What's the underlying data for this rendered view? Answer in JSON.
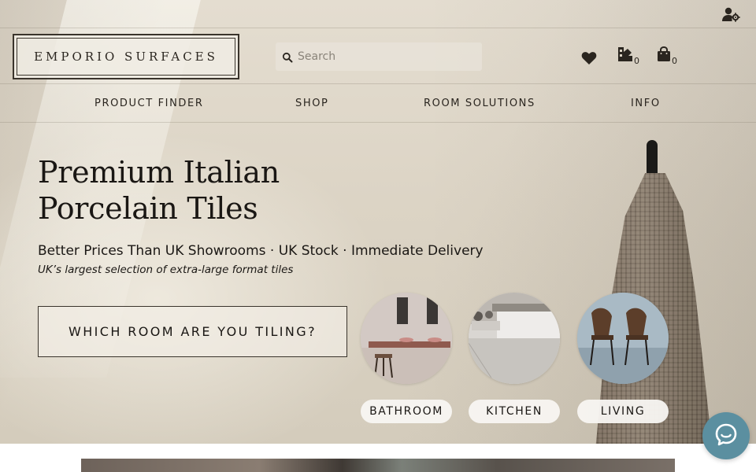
{
  "brand": {
    "logo_text": "EMPORIO SURFACES"
  },
  "search": {
    "placeholder": "Search"
  },
  "header_icons": {
    "wishlist": {
      "icon": "heart-icon"
    },
    "samples": {
      "icon": "samples-icon",
      "count": "0"
    },
    "cart": {
      "icon": "shopping-bag-icon",
      "count": "0"
    },
    "account": {
      "icon": "account-settings-icon"
    }
  },
  "nav": {
    "items": [
      {
        "label": "PRODUCT FINDER"
      },
      {
        "label": "SHOP"
      },
      {
        "label": "ROOM SOLUTIONS"
      },
      {
        "label": "INFO"
      }
    ]
  },
  "hero": {
    "title_line1": "Premium Italian",
    "title_line2": "Porcelain Tiles",
    "subtitle": "Better Prices Than UK Showrooms · UK Stock · Immediate Delivery",
    "tagline": "UK’s largest selection of extra-large format tiles",
    "cta_label": "WHICH ROOM ARE YOU TILING?"
  },
  "rooms": [
    {
      "label": "BATHROOM"
    },
    {
      "label": "KITCHEN"
    },
    {
      "label": "LIVING"
    }
  ],
  "chat": {
    "icon": "chat-icon"
  },
  "colors": {
    "accent_chat": "#5b8fa0",
    "text": "#1a1714",
    "border": "#3a342c"
  }
}
